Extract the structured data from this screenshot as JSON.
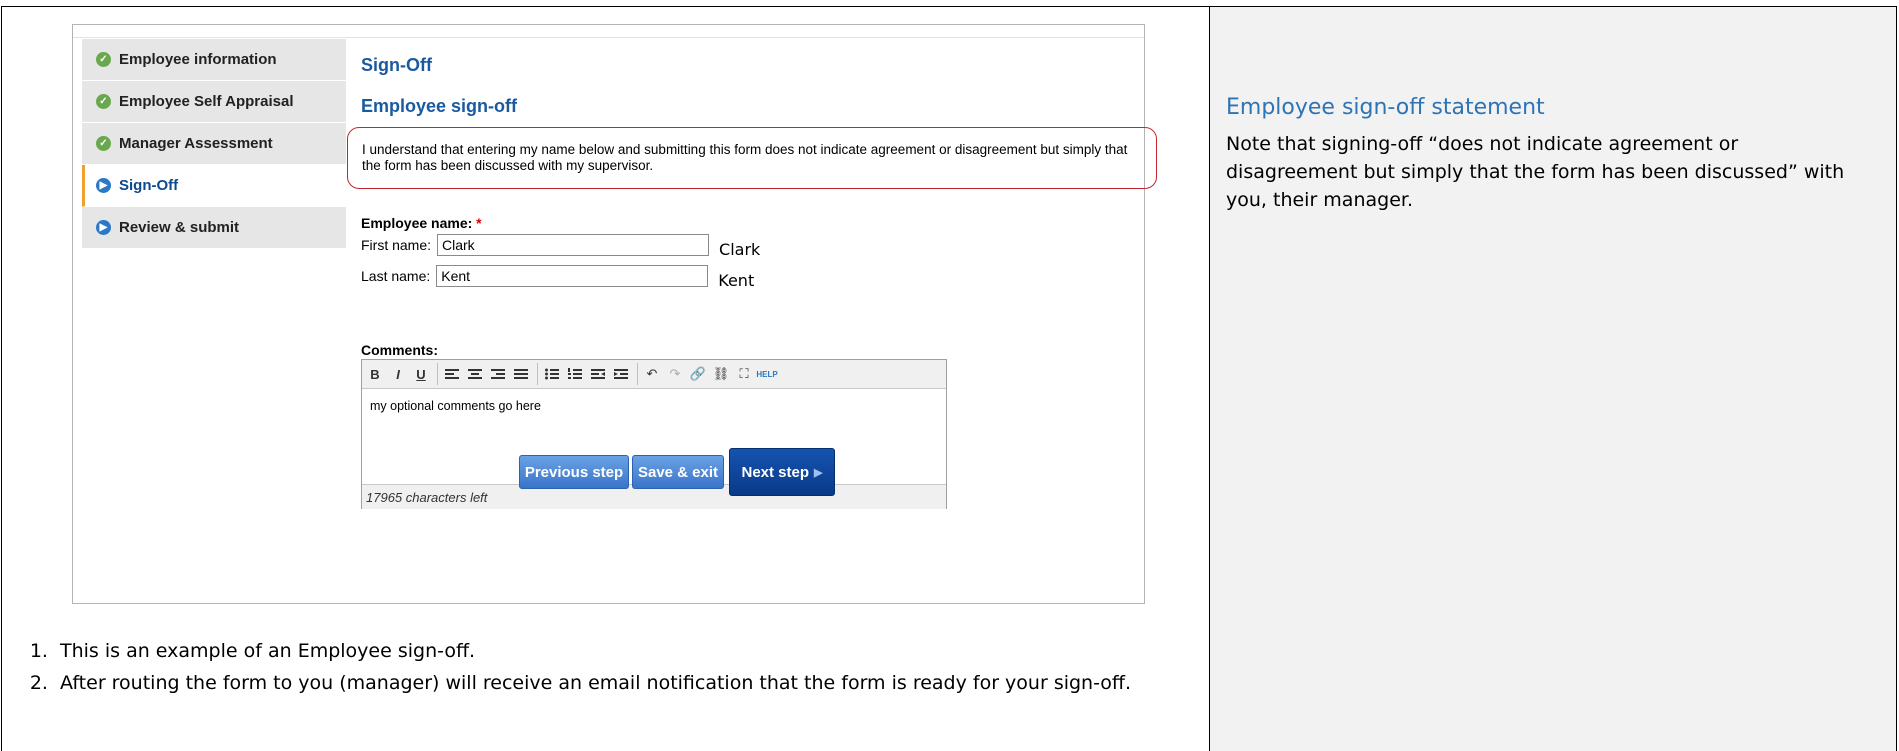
{
  "nav": {
    "items": [
      {
        "label": "Employee information",
        "state": "complete"
      },
      {
        "label": "Employee Self Appraisal",
        "state": "complete"
      },
      {
        "label": "Manager Assessment",
        "state": "complete"
      },
      {
        "label": "Sign-Off",
        "state": "current"
      },
      {
        "label": "Review & submit",
        "state": "pending"
      }
    ]
  },
  "form": {
    "title": "Sign-Off",
    "subtitle": "Employee sign-off",
    "statement": "I understand that entering my name below and submitting this form does not indicate agreement or disagreement but simply that the form has been discussed with my supervisor.",
    "employee_name_label": "Employee name:",
    "required_mark": "*",
    "first_name_label": "First name:",
    "first_name_value": "Clark",
    "first_name_echo": "Clark",
    "last_name_label": "Last name:",
    "last_name_value": "Kent",
    "last_name_echo": "Kent",
    "comments_label": "Comments:",
    "comments_text": "my optional comments go here",
    "chars_left": "17965 characters left",
    "toolbar": {
      "bold": "B",
      "italic": "I",
      "underline": "U",
      "help": "HELP"
    },
    "buttons": {
      "previous": "Previous step",
      "save": "Save & exit",
      "next": "Next step"
    }
  },
  "notes": [
    "This is an example of an Employee sign-off.",
    "After routing the form to you (manager) will receive an email notification that the form is ready for your sign-off."
  ],
  "side_panel": {
    "heading": "Employee sign-off statement",
    "body": "Note that signing-off “does not indicate agreement or disagreement but simply that the form has been discussed” with you, their manager."
  },
  "colors": {
    "accent": "#1a5aa0",
    "highlight_border": "#c0282f",
    "complete": "#6aa84f",
    "current": "#2b78c5"
  }
}
